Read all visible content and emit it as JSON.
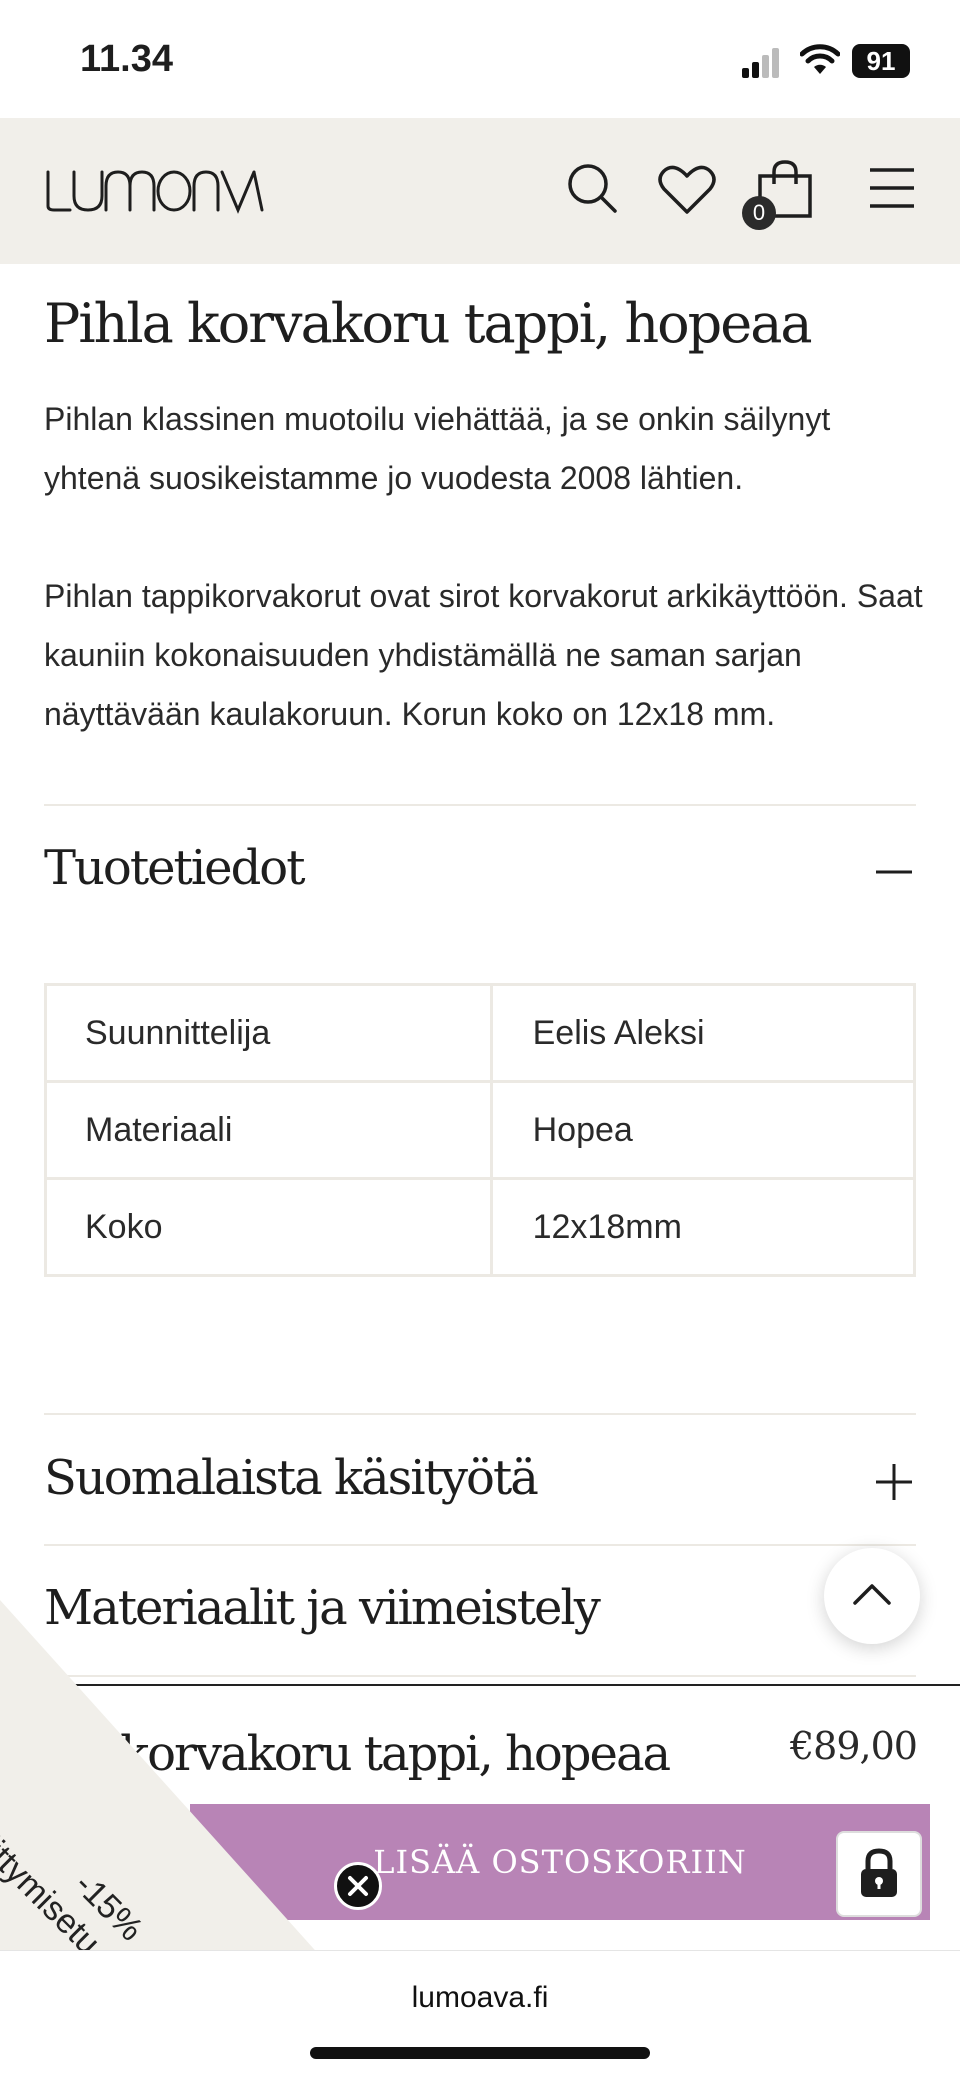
{
  "status_bar": {
    "time": "11.34",
    "battery": "91"
  },
  "header": {
    "logo": "LUMOAVA",
    "icons": [
      "search-icon",
      "heart-icon",
      "bag-icon",
      "menu-icon"
    ],
    "cart_count": "0"
  },
  "product": {
    "title": "Pihla korvakoru tappi, hopeaa",
    "description_1": "Pihlan klassinen muotoilu viehättää, ja se onkin säilynyt yhtenä suosikeistamme jo vuodesta 2008 lähtien.",
    "description_2": "Pihlan tappikorvakorut ovat sirot korvakorut arkikäyttöön. Saat kauniin kokonaisuuden yhdistämällä ne saman sarjan näyttävään kaulakoruun. Korun koko on 12x18 mm."
  },
  "details": {
    "title": "Tuotetiedot",
    "rows": [
      {
        "label": "Suunnittelija",
        "value": "Eelis Aleksi"
      },
      {
        "label": "Materiaali",
        "value": "Hopea"
      },
      {
        "label": "Koko",
        "value": "12x18mm"
      }
    ]
  },
  "accordion": {
    "handcraft": "Suomalaista käsityötä",
    "materials": "Materiaalit ja viimeistely"
  },
  "sticky": {
    "name": "korvakoru tappi, hopeaa",
    "price": "€89,00",
    "add_to_cart": "LISÄÄ OSTOSKORIIN"
  },
  "promo": {
    "discount": "-15%",
    "text": "liittymisetu"
  },
  "browser": {
    "url": "lumoava.fi"
  },
  "colors": {
    "header_bg": "#f1efea",
    "button": "#b884b6",
    "divider": "#ece9e3"
  }
}
